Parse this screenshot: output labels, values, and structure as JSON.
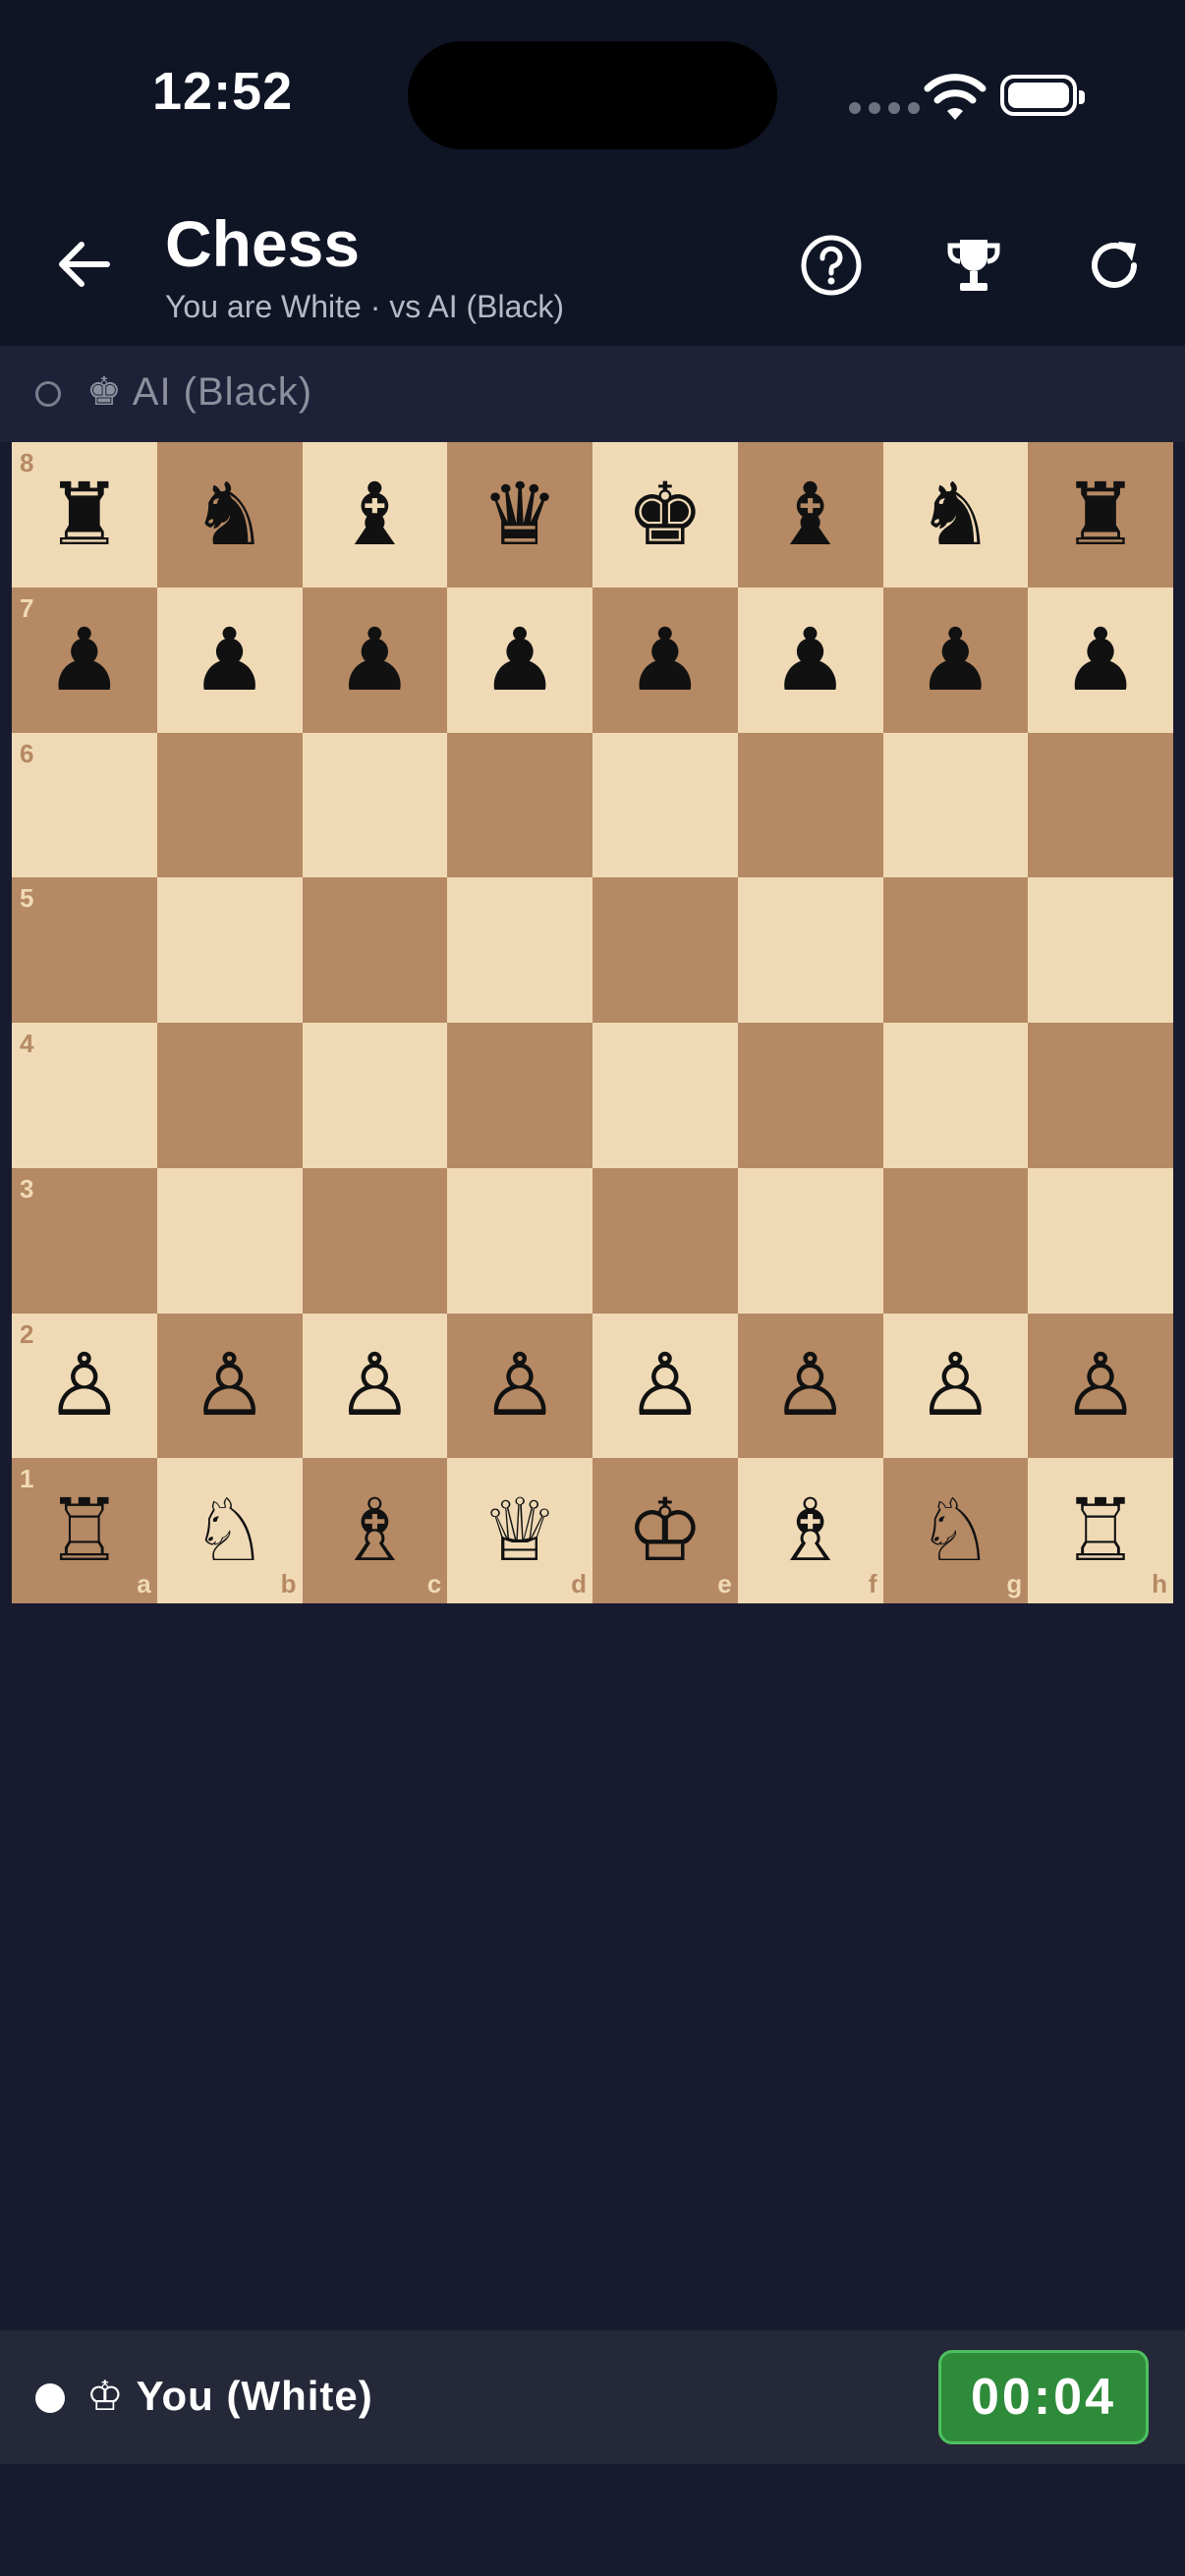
{
  "status_bar": {
    "time": "12:52"
  },
  "header": {
    "title": "Chess",
    "subtitle": "You are White · vs AI (Black)"
  },
  "opponent": {
    "label": "♚ AI (Black)"
  },
  "you": {
    "label": "♔ You (White)",
    "timer": "00:04"
  },
  "board": {
    "rows": [
      {
        "rank": "8",
        "cells": [
          {
            "glyph": "♜",
            "color": "black"
          },
          {
            "glyph": "♞",
            "color": "black"
          },
          {
            "glyph": "♝",
            "color": "black"
          },
          {
            "glyph": "♛",
            "color": "black"
          },
          {
            "glyph": "♚",
            "color": "black"
          },
          {
            "glyph": "♝",
            "color": "black"
          },
          {
            "glyph": "♞",
            "color": "black"
          },
          {
            "glyph": "♜",
            "color": "black"
          }
        ]
      },
      {
        "rank": "7",
        "cells": [
          {
            "glyph": "♟",
            "color": "black"
          },
          {
            "glyph": "♟",
            "color": "black"
          },
          {
            "glyph": "♟",
            "color": "black"
          },
          {
            "glyph": "♟",
            "color": "black"
          },
          {
            "glyph": "♟",
            "color": "black"
          },
          {
            "glyph": "♟",
            "color": "black"
          },
          {
            "glyph": "♟",
            "color": "black"
          },
          {
            "glyph": "♟",
            "color": "black"
          }
        ]
      },
      {
        "rank": "6",
        "cells": [
          {
            "glyph": ""
          },
          {
            "glyph": ""
          },
          {
            "glyph": ""
          },
          {
            "glyph": ""
          },
          {
            "glyph": ""
          },
          {
            "glyph": ""
          },
          {
            "glyph": ""
          },
          {
            "glyph": ""
          }
        ]
      },
      {
        "rank": "5",
        "cells": [
          {
            "glyph": ""
          },
          {
            "glyph": ""
          },
          {
            "glyph": ""
          },
          {
            "glyph": ""
          },
          {
            "glyph": ""
          },
          {
            "glyph": ""
          },
          {
            "glyph": ""
          },
          {
            "glyph": ""
          }
        ]
      },
      {
        "rank": "4",
        "cells": [
          {
            "glyph": ""
          },
          {
            "glyph": ""
          },
          {
            "glyph": ""
          },
          {
            "glyph": ""
          },
          {
            "glyph": ""
          },
          {
            "glyph": ""
          },
          {
            "glyph": ""
          },
          {
            "glyph": ""
          }
        ]
      },
      {
        "rank": "3",
        "cells": [
          {
            "glyph": ""
          },
          {
            "glyph": ""
          },
          {
            "glyph": ""
          },
          {
            "glyph": ""
          },
          {
            "glyph": ""
          },
          {
            "glyph": ""
          },
          {
            "glyph": ""
          },
          {
            "glyph": ""
          }
        ]
      },
      {
        "rank": "2",
        "cells": [
          {
            "glyph": "♙",
            "color": "white"
          },
          {
            "glyph": "♙",
            "color": "white"
          },
          {
            "glyph": "♙",
            "color": "white"
          },
          {
            "glyph": "♙",
            "color": "white"
          },
          {
            "glyph": "♙",
            "color": "white"
          },
          {
            "glyph": "♙",
            "color": "white"
          },
          {
            "glyph": "♙",
            "color": "white"
          },
          {
            "glyph": "♙",
            "color": "white"
          }
        ]
      },
      {
        "rank": "1",
        "cells": [
          {
            "glyph": "♖",
            "color": "white"
          },
          {
            "glyph": "♘",
            "color": "white"
          },
          {
            "glyph": "♗",
            "color": "white"
          },
          {
            "glyph": "♕",
            "color": "white"
          },
          {
            "glyph": "♔",
            "color": "white"
          },
          {
            "glyph": "♗",
            "color": "white"
          },
          {
            "glyph": "♘",
            "color": "white"
          },
          {
            "glyph": "♖",
            "color": "white"
          }
        ]
      }
    ],
    "files": [
      "a",
      "b",
      "c",
      "d",
      "e",
      "f",
      "g",
      "h"
    ]
  },
  "colors": {
    "light_square": "#f0dab6",
    "dark_square": "#b58963",
    "timer_bg": "#2e8b3a"
  }
}
